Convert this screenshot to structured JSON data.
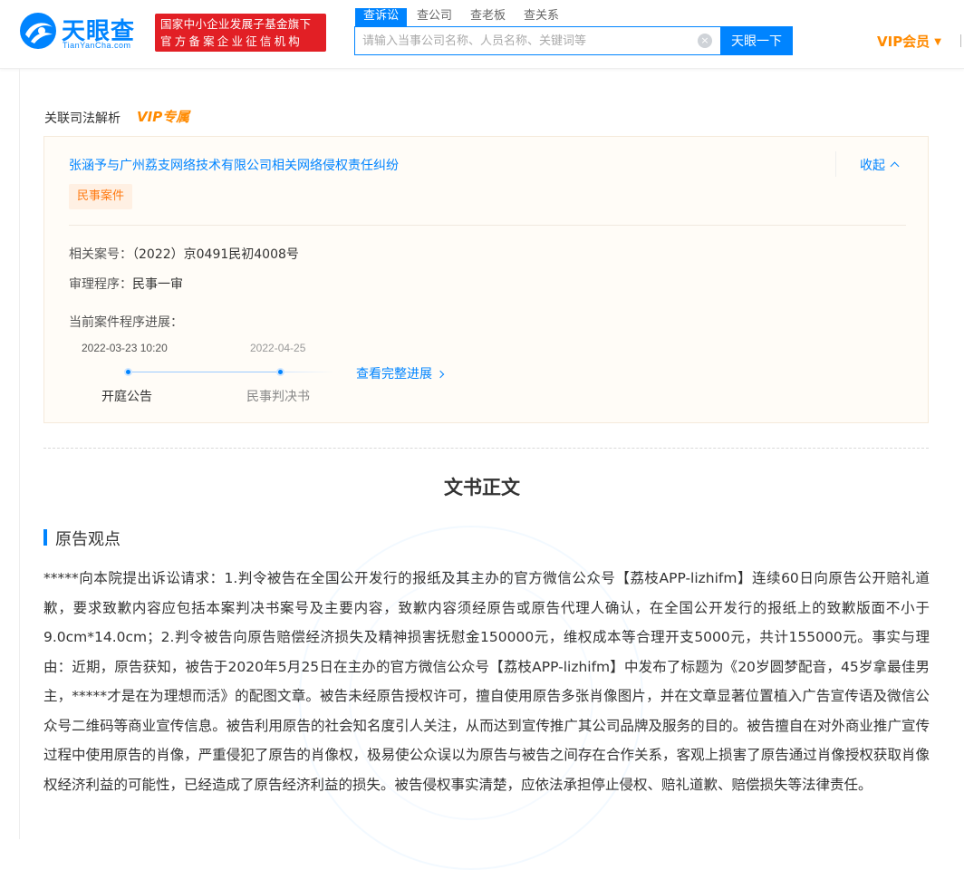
{
  "header": {
    "logo_text": "天眼查",
    "logo_sub": "TianYanCha.com",
    "badge_line1": "国家中小企业发展子基金旗下",
    "badge_line2": "官方备案企业征信机构",
    "search_tabs": [
      "查诉讼",
      "查公司",
      "查老板",
      "查关系"
    ],
    "search_placeholder": "请输入当事公司名称、人员名称、关键词等",
    "search_button": "天眼一下",
    "vip_menu": "VIP会员"
  },
  "section": {
    "title": "关联司法解析",
    "vip_tag": "VIP专属"
  },
  "case": {
    "title": "张涵予与广州荔支网络技术有限公司相关网络侵权责任纠纷",
    "collapse_label": "收起",
    "tag": "民事案件",
    "case_no_label": "相关案号：",
    "case_no_value": "（2022）京0491民初4008号",
    "procedure_label": "审理程序：",
    "procedure_value": "民事一审",
    "progress_label": "当前案件程序进展：",
    "timeline": [
      {
        "date": "2022-03-23 10:20",
        "label": "开庭公告"
      },
      {
        "date": "2022-04-25",
        "label": "民事判决书"
      }
    ],
    "view_full": "查看完整进展"
  },
  "document": {
    "title": "文书正文",
    "section_title": "原告观点",
    "body": "*****向本院提出诉讼请求：1.判令被告在全国公开发行的报纸及其主办的官方微信公众号【荔枝APP-lizhifm】连续60日向原告公开赔礼道歉，要求致歉内容应包括本案判决书案号及主要内容，致歉内容须经原告或原告代理人确认，在全国公开发行的报纸上的致歉版面不小于9.0cm*14.0cm；2.判令被告向原告赔偿经济损失及精神损害抚慰金150000元，维权成本等合理开支5000元，共计155000元。事实与理由：近期，原告获知，被告于2020年5月25日在主办的官方微信公众号【荔枝APP-lizhifm】中发布了标题为《20岁圆梦配音，45岁拿最佳男主，*****才是在为理想而活》的配图文章。被告未经原告授权许可，擅自使用原告多张肖像图片，并在文章显著位置植入广告宣传语及微信公众号二维码等商业宣传信息。被告利用原告的社会知名度引人关注，从而达到宣传推广其公司品牌及服务的目的。被告擅自在对外商业推广宣传过程中使用原告的肖像，严重侵犯了原告的肖像权，极易使公众误以为原告与被告之间存在合作关系，客观上损害了原告通过肖像授权获取肖像权经济利益的可能性，已经造成了原告经济利益的损失。被告侵权事实清楚，应依法承担停止侵权、赔礼道歉、赔偿损失等法律责任。"
  },
  "colors": {
    "brand_blue": "#0084ff",
    "vip_orange": "#ff8a00",
    "badge_red": "#e21f25",
    "tag_orange": "#ff7a12"
  }
}
